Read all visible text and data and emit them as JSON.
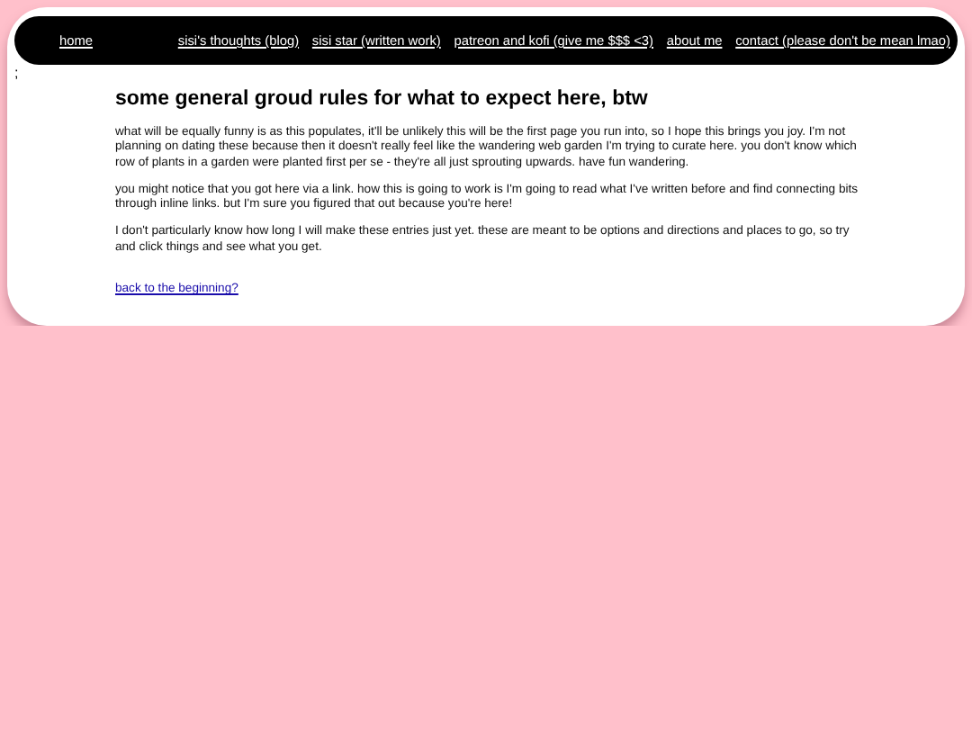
{
  "nav": [
    "home",
    "sisi's thoughts (blog)",
    "sisi star (written work)",
    "patreon and kofi (give me $$$ <3)",
    "about me",
    "contact (please don't be mean lmao)"
  ],
  "stray_text": ";",
  "heading": "some general groud rules for what to expect here, btw",
  "paragraphs": [
    "what will be equally funny is as this populates, it'll be unlikely this will be the first page you run into, so I hope this brings you joy. I'm not planning on dating these because then it doesn't really feel like the wandering web garden I'm trying to curate here. you don't know which row of plants in a garden were planted first per se - they're all just sprouting upwards. have fun wandering.",
    "you might notice that you got here via a link. how this is going to work is I'm going to read what I've written before and find connecting bits through inline links. but I'm sure you figured that out because you're here!",
    "I don't particularly know how long I will make these entries just yet. these are meant to be options and directions and places to go, so try and click things and see what you get."
  ],
  "back_link": "back to the beginning?"
}
